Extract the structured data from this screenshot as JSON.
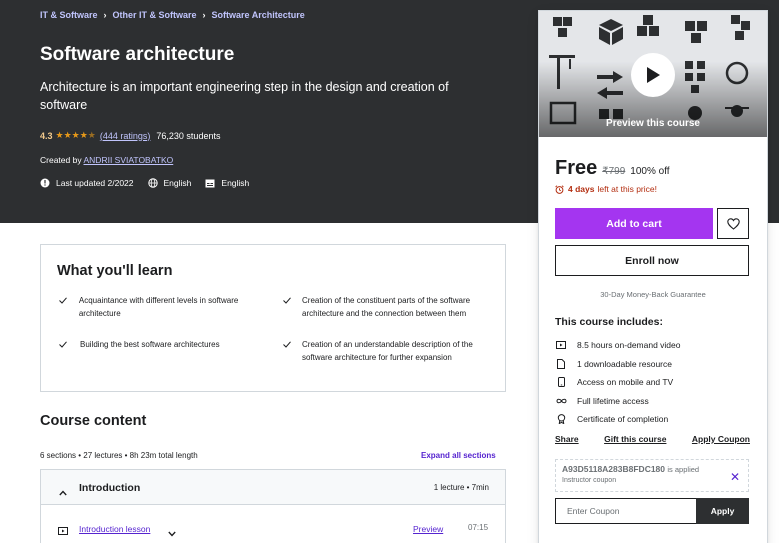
{
  "breadcrumb": [
    "IT & Software",
    "Other IT & Software",
    "Software Architecture"
  ],
  "course": {
    "title": "Software architecture",
    "subtitle": "Architecture is an important engineering step in the design and creation of software",
    "rating": "4.3",
    "rating_stars": 4.3,
    "ratings_count": "(444 ratings)",
    "students": "76,230 students",
    "created_by_label": "Created by",
    "instructor": "ANDRII SVIATOBATKO",
    "last_updated": "Last updated 2/2022",
    "language": "English",
    "captions": "English"
  },
  "sidebar": {
    "preview_label": "Preview this course",
    "price": "Free",
    "original_price": "₹799",
    "discount": "100% off",
    "deadline_bold": "4 days",
    "deadline_rest": "left at this price!",
    "add_to_cart": "Add to cart",
    "enroll": "Enroll now",
    "guarantee": "30-Day Money-Back Guarantee",
    "includes_title": "This course includes:",
    "includes": [
      {
        "icon": "video-icon",
        "text": "8.5 hours on-demand video"
      },
      {
        "icon": "file-icon",
        "text": "1 downloadable resource"
      },
      {
        "icon": "mobile-icon",
        "text": "Access on mobile and TV"
      },
      {
        "icon": "infinity-icon",
        "text": "Full lifetime access"
      },
      {
        "icon": "trophy-icon",
        "text": "Certificate of completion"
      }
    ],
    "share": "Share",
    "gift": "Gift this course",
    "apply_coupon": "Apply Coupon",
    "coupon_code": "A93D5118A283B8FDC180",
    "coupon_applied": "is applied",
    "coupon_sub": "Instructor coupon",
    "coupon_placeholder": "Enter Coupon",
    "apply": "Apply"
  },
  "learn": {
    "title": "What you'll learn",
    "items": [
      "Acquaintance with different levels in software architecture",
      "Creation of the constituent parts of the software architecture and the connection between them",
      "Building the best software architectures",
      "Creation of an understandable description of the software architecture for further expansion"
    ]
  },
  "content": {
    "title": "Course content",
    "meta": "6 sections • 27 lectures • 8h 23m total length",
    "expand": "Expand all sections",
    "section": {
      "name": "Introduction",
      "info": "1 lecture • 7min"
    },
    "lecture": {
      "name": "Introduction lesson",
      "preview": "Preview",
      "time": "07:15"
    }
  },
  "colors": {
    "accent": "#a435f0",
    "link": "#5624d0",
    "hero": "#2d2f31",
    "star": "#e59819",
    "warning": "#b32d0f"
  }
}
